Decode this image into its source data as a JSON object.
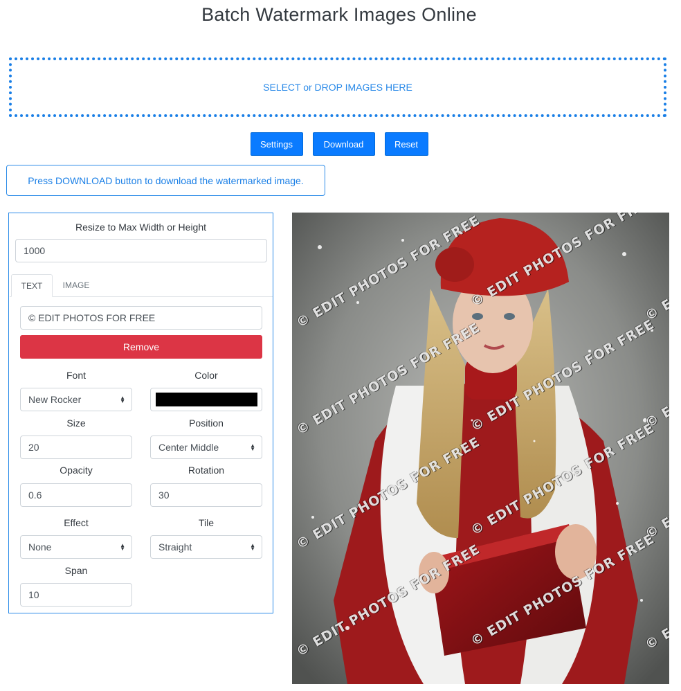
{
  "page": {
    "title": "Batch Watermark Images Online"
  },
  "dropzone": {
    "label": "SELECT or DROP IMAGES HERE"
  },
  "buttons": {
    "settings": "Settings",
    "download": "Download",
    "reset": "Reset"
  },
  "notice": {
    "text": "Press DOWNLOAD button to download the watermarked image."
  },
  "panel": {
    "resize_label": "Resize to Max Width or Height",
    "resize_value": "1000",
    "tabs": [
      {
        "label": "TEXT",
        "active": true
      },
      {
        "label": "IMAGE",
        "active": false
      }
    ],
    "watermark_text": "© EDIT PHOTOS FOR FREE",
    "remove_label": "Remove",
    "fields": {
      "font": {
        "label": "Font",
        "value": "New Rocker"
      },
      "color": {
        "label": "Color",
        "value": "#000000"
      },
      "size": {
        "label": "Size",
        "value": "20"
      },
      "position": {
        "label": "Position",
        "value": "Center Middle"
      },
      "opacity": {
        "label": "Opacity",
        "value": "0.6"
      },
      "rotation": {
        "label": "Rotation",
        "value": "30"
      },
      "effect": {
        "label": "Effect",
        "value": "None"
      },
      "tile": {
        "label": "Tile",
        "value": "Straight"
      },
      "span": {
        "label": "Span",
        "value": "10"
      }
    }
  },
  "preview": {
    "watermark_text": "© EDIT PHOTOS FOR FREE"
  },
  "colors": {
    "primary": "#0a7bff",
    "danger": "#dc3545",
    "border_accent": "#2a8ae8"
  }
}
